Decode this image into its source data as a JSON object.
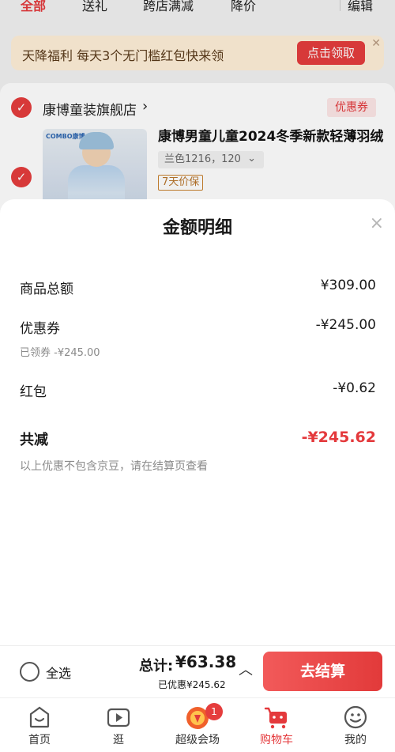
{
  "top_tabs": [
    {
      "label": "全部",
      "active": true
    },
    {
      "label": "送礼",
      "active": false
    },
    {
      "label": "跨店满减",
      "active": false
    },
    {
      "label": "降价",
      "active": false
    }
  ],
  "edit_label": "编辑",
  "welfare_banner": {
    "text": "天降福利 每天3个无门槛红包快来领",
    "button": "点击领取",
    "close_icon": "✕"
  },
  "shop": {
    "name": "康博童装旗舰店",
    "arrow": "›",
    "coupon_tag": "优惠券",
    "check_icon": "✓"
  },
  "product": {
    "image_brand": "COMBO康博",
    "title": "康博男童儿童2024冬季新款轻薄羽绒",
    "sku": "兰色1216，120",
    "sku_chevron": "⌄",
    "price_tag": "7天价保"
  },
  "sheet": {
    "title": "金额明细",
    "close_icon": "×",
    "rows": [
      {
        "label": "商品总额",
        "value": "¥309.00"
      },
      {
        "label": "优惠券",
        "value": "-¥245.00",
        "sub": "已领券 -¥245.00"
      },
      {
        "label": "红包",
        "value": "-¥0.62"
      }
    ],
    "total_label": "共减",
    "total_value": "-¥245.62",
    "note": "以上优惠不包含京豆，请在结算页查看"
  },
  "bottom_bar": {
    "select_all": "全选",
    "sum_label": "总计:",
    "sum_value": "¥63.38",
    "saved": "已优惠¥245.62",
    "chevron": "︿",
    "checkout": "去结算"
  },
  "tabbar": [
    {
      "label": "首页",
      "icon": "home-icon",
      "active": false
    },
    {
      "label": "逛",
      "icon": "video-icon",
      "active": false
    },
    {
      "label": "超级会场",
      "icon": "event-icon",
      "active": false,
      "badge": "1"
    },
    {
      "label": "购物车",
      "icon": "cart-icon",
      "active": true
    },
    {
      "label": "我的",
      "icon": "profile-icon",
      "active": false
    }
  ],
  "colors": {
    "accent": "#e4393c",
    "checkout": "#e23a3a",
    "welfare_bg": "#fff0d8"
  }
}
